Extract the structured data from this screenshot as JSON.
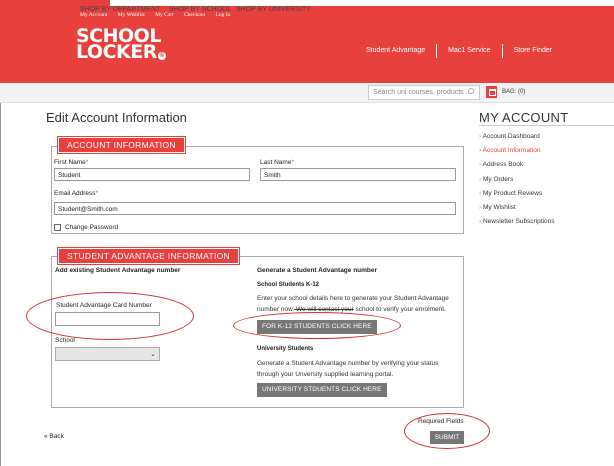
{
  "header": {
    "top_links": [
      "My Account",
      "My Wishlist",
      "My Cart",
      "Checkout",
      "Log In"
    ],
    "logo_line1": "SCHOOL",
    "logo_line2": "LOCKER",
    "logo_mark": "®",
    "right_links": [
      "Student Advantage",
      "Mac1 Service",
      "Store Finder"
    ]
  },
  "nav": {
    "items": [
      "SHOP BY DEPARTMENT",
      "SHOP BY SCHOOL",
      "SHOP BY UNIVERSITY"
    ],
    "search_placeholder": "Search uni courses, products ...",
    "bag_label": "BAG: (0)"
  },
  "page": {
    "title": "Edit Account Information"
  },
  "sidebar": {
    "title": "MY ACCOUNT",
    "items": [
      {
        "label": "Account Dashboard"
      },
      {
        "label": "Account Information"
      },
      {
        "label": "Address Book"
      },
      {
        "label": "My Orders"
      },
      {
        "label": "My Product Reviews"
      },
      {
        "label": "My Wishlist"
      },
      {
        "label": "Newsletter Subscriptions"
      }
    ]
  },
  "account_info": {
    "legend": "ACCOUNT INFORMATION",
    "first_name_label": "First Name",
    "first_name_value": "Student",
    "last_name_label": "Last Name",
    "last_name_value": "Smith",
    "email_label": "Email Address",
    "email_value": "Student@Smith.com",
    "change_password_label": "Change Password",
    "required_mark": "*"
  },
  "student_advantage": {
    "legend": "STUDENT ADVANTAGE INFORMATION",
    "existing_heading": "Add existing Student Advantage number",
    "card_number_label": "Student Advantage Card Number",
    "card_number_value": "",
    "school_label": "School",
    "school_selected": "",
    "generate_heading": "Generate a Student Advantage number",
    "k12_heading": "School Students K-12",
    "k12_text_1": "Enter your school details here to generate your Student Advantage",
    "k12_text_2a": "number now.",
    "k12_text_2b": " We will contact your",
    "k12_text_2c": " school to verify your enrolment.",
    "k12_button": "FOR K-12 STUDENTS CLICK HERE",
    "uni_heading": "University Students",
    "uni_text_1": "Generate a Student Advantage number by verifying your status",
    "uni_text_2": "through your Unversity supplied learning portal.",
    "uni_button": "UNIVERSITY STDUENTS CLICK HERE"
  },
  "footer": {
    "back_label": "« Back",
    "required_fields": "Required Fields",
    "submit_label": "SUBMIT"
  },
  "colors": {
    "brand_red": "#e8403c",
    "annotation_red": "#d32f2f",
    "button_grey": "#777777"
  }
}
